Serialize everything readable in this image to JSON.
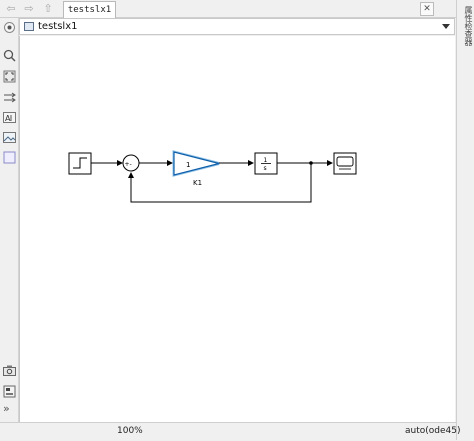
{
  "toolbar": {
    "back_icon": "back-arrow-icon",
    "forward_icon": "forward-arrow-icon",
    "up_icon": "up-icon"
  },
  "tab": {
    "label": "testslx1"
  },
  "breadcrumb": {
    "label": "testslx1"
  },
  "property_panel": {
    "label": "属性检查器"
  },
  "diagram": {
    "gain_label": "K1",
    "gain_value": "1",
    "integrator_numerator": "1",
    "integrator_denominator": "s",
    "sum_signs": "+-"
  },
  "status": {
    "zoom": "100%",
    "solver": "auto(ode45)"
  },
  "colors": {
    "gain_highlight": "#2e8bd6",
    "line": "#000000",
    "canvas": "#ffffff"
  }
}
